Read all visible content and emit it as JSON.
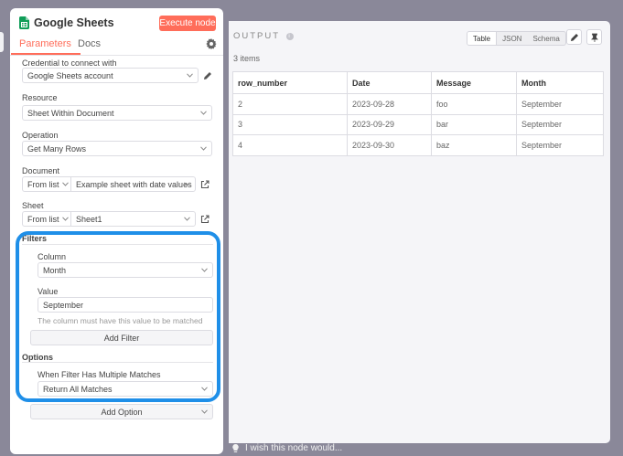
{
  "node": {
    "title": "Google Sheets",
    "execute_label": "Execute node",
    "tabs": [
      {
        "label": "Parameters"
      },
      {
        "label": "Docs"
      }
    ]
  },
  "params": {
    "credential": {
      "label": "Credential to connect with",
      "value": "Google Sheets account"
    },
    "resource": {
      "label": "Resource",
      "value": "Sheet Within Document"
    },
    "operation": {
      "label": "Operation",
      "value": "Get Many Rows"
    },
    "document": {
      "label": "Document",
      "mode": "From list",
      "value": "Example sheet with date values"
    },
    "sheet": {
      "label": "Sheet",
      "mode": "From list",
      "value": "Sheet1"
    }
  },
  "filters": {
    "title": "Filters",
    "column": {
      "label": "Column",
      "value": "Month"
    },
    "value": {
      "label": "Value",
      "value": "September",
      "hint": "The column must have this value to be matched"
    },
    "add_filter_label": "Add Filter"
  },
  "options": {
    "title": "Options",
    "multiple_matches": {
      "label": "When Filter Has Multiple Matches",
      "value": "Return All Matches"
    },
    "add_option_label": "Add Option"
  },
  "output": {
    "title": "OUTPUT",
    "views": [
      {
        "label": "Table"
      },
      {
        "label": "JSON"
      },
      {
        "label": "Schema"
      }
    ],
    "active_view": "Table",
    "count": "3 items",
    "columns": [
      "row_number",
      "Date",
      "Message",
      "Month"
    ],
    "rows": [
      [
        "2",
        "2023-09-28",
        "foo",
        "September"
      ],
      [
        "3",
        "2023-09-29",
        "bar",
        "September"
      ],
      [
        "4",
        "2023-09-30",
        "baz",
        "September"
      ]
    ]
  },
  "footer": {
    "text": "I wish this node would..."
  },
  "colors": {
    "accent": "#ff6d5a",
    "highlight": "#1f8fe8",
    "sheets_green": "#0f9d58"
  },
  "icons": [
    "google-sheets-icon",
    "gear-icon",
    "pencil-icon",
    "external-link-icon",
    "chevron-down-icon",
    "info-icon",
    "pin-icon",
    "lightbulb-icon"
  ]
}
